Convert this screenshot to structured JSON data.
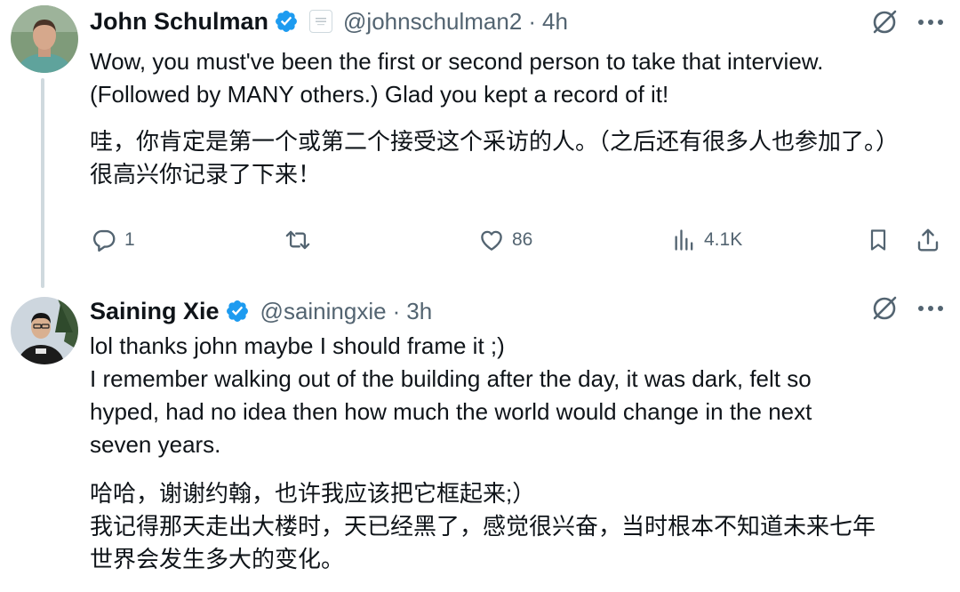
{
  "tweets": [
    {
      "author_name": "John Schulman",
      "handle": "@johnschulman2",
      "separator": "·",
      "time": "4h",
      "text_en": [
        "Wow, you must've been the first or second person to take that interview.",
        "(Followed by MANY others.) Glad you kept a record of it!"
      ],
      "text_zh": [
        "哇，你肯定是第一个或第二个接受这个采访的人。（之后还有很多人也参加了。）",
        "很高兴你记录了下来！"
      ],
      "actions": {
        "reply_count": "1",
        "retweet_count": "",
        "like_count": "86",
        "views_count": "4.1K"
      }
    },
    {
      "author_name": "Saining Xie",
      "handle": "@sainingxie",
      "separator": "·",
      "time": "3h",
      "text_en": [
        "lol thanks john maybe I should frame it ;)",
        "I remember walking out of the building after the day, it was dark, felt so",
        "hyped, had no idea then how much the world would change in the next",
        "seven years."
      ],
      "text_zh": [
        "哈哈，谢谢约翰，也许我应该把它框起来;）",
        "我记得那天走出大楼时，天已经黑了，感觉很兴奋，当时根本不知道未来七年",
        "世界会发生多大的变化。"
      ]
    }
  ],
  "colors": {
    "text": "#0f1419",
    "muted": "#536471",
    "verified": "#1d9bf0",
    "thread_line": "#cfd9de"
  },
  "icons": {
    "verified": "verified-badge-icon",
    "affiliate": "affiliate-badge-icon",
    "grok": "grok-icon",
    "more": "more-icon",
    "reply": "reply-icon",
    "retweet": "retweet-icon",
    "like": "like-icon",
    "views": "views-icon",
    "bookmark": "bookmark-icon",
    "share": "share-icon"
  }
}
